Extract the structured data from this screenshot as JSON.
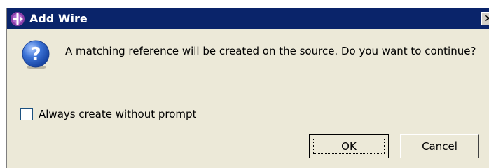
{
  "window": {
    "title": "Add Wire",
    "close_glyph": "✕"
  },
  "dialog": {
    "message": "A matching reference will be created on the source. Do you want to continue?",
    "icon": "question-icon",
    "checkbox": {
      "label": "Always create without prompt",
      "checked": false
    }
  },
  "buttons": {
    "ok": "OK",
    "cancel": "Cancel"
  },
  "colors": {
    "titlebar": "#0a246a",
    "dialog_bg": "#ece9d8",
    "icon_blue": "#2a5bc0"
  }
}
